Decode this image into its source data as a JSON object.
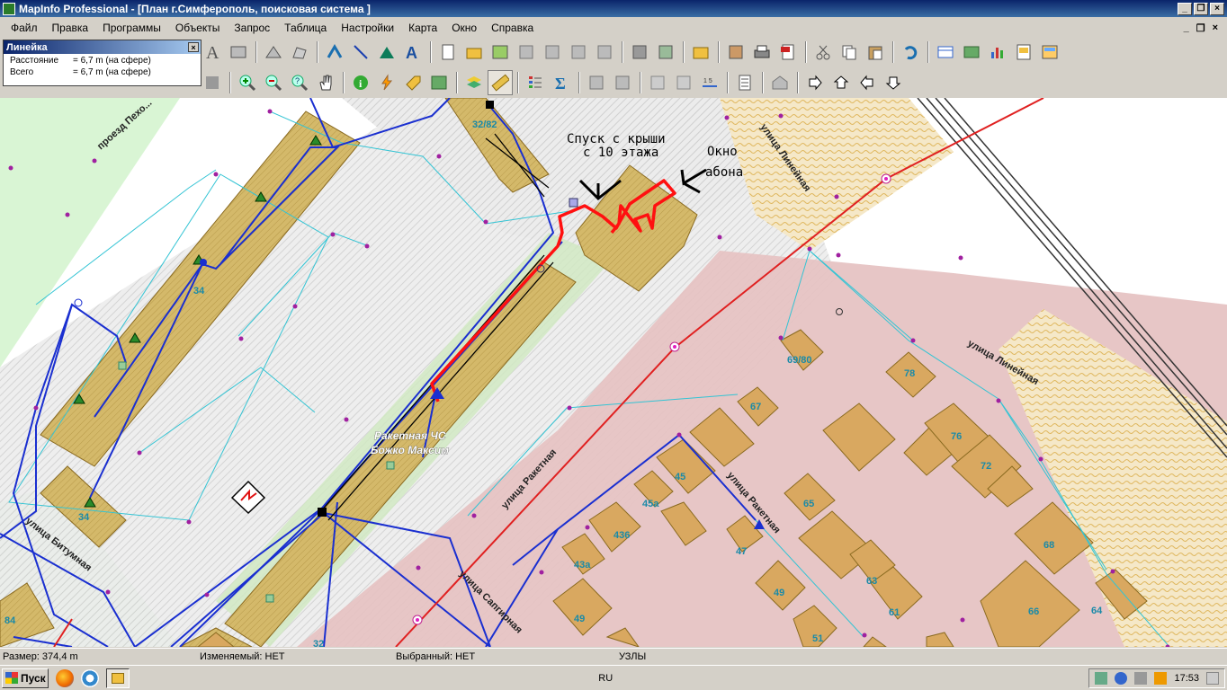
{
  "window": {
    "title": "MapInfo Professional - [План г.Симферополь, поисковая система ]"
  },
  "menu": [
    "Файл",
    "Правка",
    "Программы",
    "Объекты",
    "Запрос",
    "Таблица",
    "Настройки",
    "Карта",
    "Окно",
    "Справка"
  ],
  "ruler": {
    "title": "Линейка",
    "rows": [
      {
        "label": "Расстояние",
        "value": "= 6,7 m (на сфере)"
      },
      {
        "label": "Всего",
        "value": "= 6,7 m (на сфере)"
      }
    ]
  },
  "map": {
    "streets": [
      "проезд Пехо...",
      "улица Линейная",
      "улица Линейная",
      "улица Ракетная",
      "улица Ракетная",
      "улица Сапгирная",
      "улица Битумная"
    ],
    "annotations": {
      "descent": "Спуск с крыши",
      "descent2": "с 10 этажа",
      "window1": "Окно",
      "window2": "абона"
    },
    "labels": {
      "subscriber1": "Ракетная ЧС",
      "subscriber2": "Божко Максим"
    },
    "buildings": [
      "32/82",
      "34",
      "34",
      "84",
      "32",
      "69/80",
      "78",
      "67",
      "76",
      "72",
      "45",
      "45а",
      "436",
      "43а",
      "65",
      "47",
      "63",
      "68",
      "49",
      "61",
      "66",
      "64",
      "49",
      "51"
    ]
  },
  "status": {
    "size": "Размер: 374,4 m",
    "editable": "Изменяемый: НЕТ",
    "selected": "Выбранный: НЕТ",
    "mode": "УЗЛЫ"
  },
  "taskbar": {
    "start": "Пуск",
    "lang": "RU",
    "time": "17:53"
  }
}
